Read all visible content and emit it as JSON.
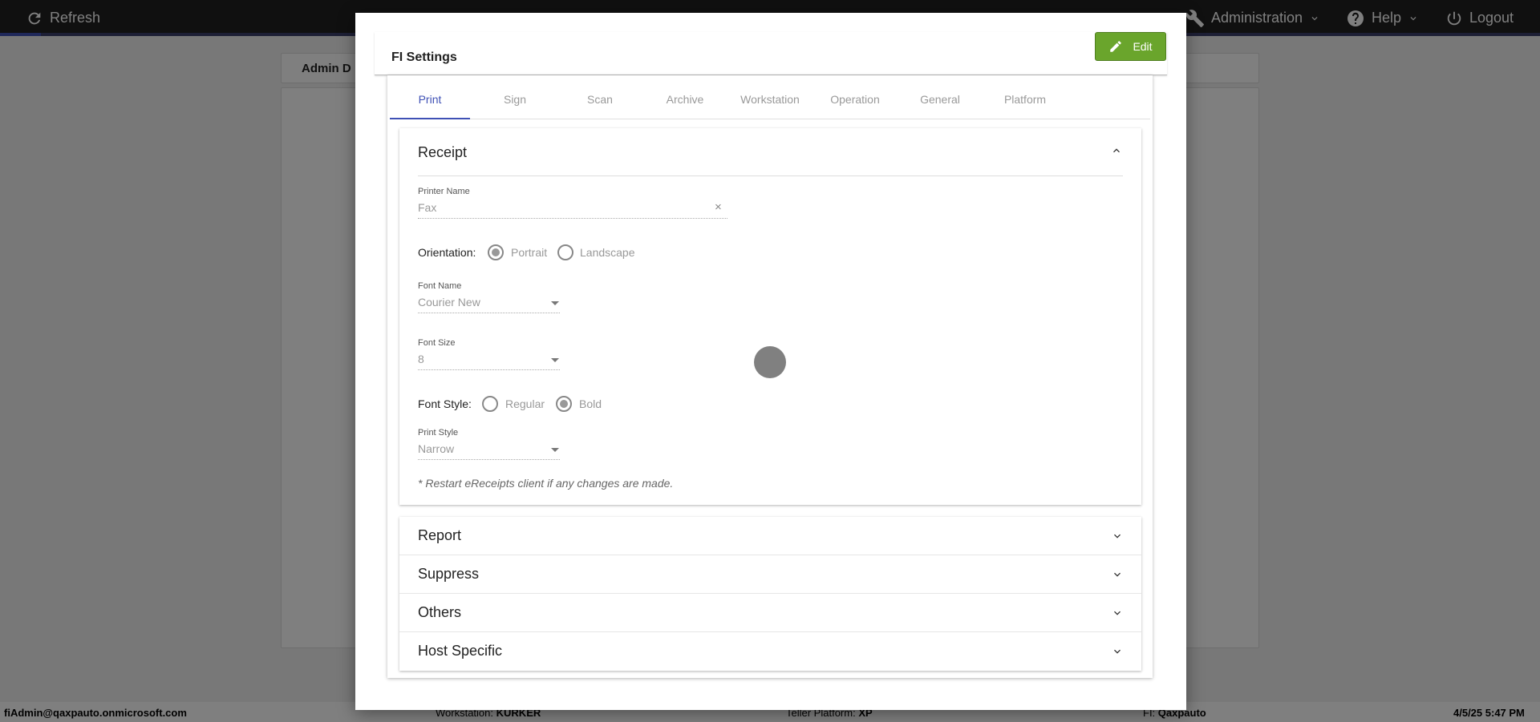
{
  "topbar": {
    "refresh_label": "Refresh",
    "administration_label": "Administration",
    "help_label": "Help",
    "logout_label": "Logout"
  },
  "background": {
    "header_text": "Admin D"
  },
  "footer": {
    "user": "fiAdmin@qaxpauto.onmicrosoft.com",
    "workstation_label": "Workstation:",
    "workstation_value": "KURKER",
    "teller_platform_label": "Teller Platform:",
    "teller_platform_value": "XP",
    "fi_label": "FI:",
    "fi_value": "Qaxpauto",
    "datetime": "4/5/25 5:47 PM"
  },
  "modal": {
    "title": "FI Settings",
    "edit_label": "Edit",
    "tabs": [
      {
        "label": "Print",
        "active": true
      },
      {
        "label": "Sign"
      },
      {
        "label": "Scan"
      },
      {
        "label": "Archive"
      },
      {
        "label": "Workstation"
      },
      {
        "label": "Operation"
      },
      {
        "label": "General"
      },
      {
        "label": "Platform"
      }
    ],
    "receipt": {
      "title": "Receipt",
      "printer_name_label": "Printer Name",
      "printer_name_value": "Fax",
      "clear_symbol": "×",
      "orientation_label": "Orientation:",
      "orientation_options": [
        "Portrait",
        "Landscape"
      ],
      "orientation_selected": "Portrait",
      "font_name_label": "Font Name",
      "font_name_value": "Courier New",
      "font_size_label": "Font Size",
      "font_size_value": "8",
      "font_style_label": "Font Style:",
      "font_style_options": [
        "Regular",
        "Bold"
      ],
      "font_style_selected": "Bold",
      "print_style_label": "Print Style",
      "print_style_value": "Narrow",
      "note": "* Restart eReceipts client if any changes are made."
    },
    "sections": [
      "Report",
      "Suppress",
      "Others",
      "Host Specific"
    ]
  },
  "colors": {
    "accent": "#3f51b5",
    "edit_button": "#6aa52c",
    "topbar": "#202020"
  }
}
